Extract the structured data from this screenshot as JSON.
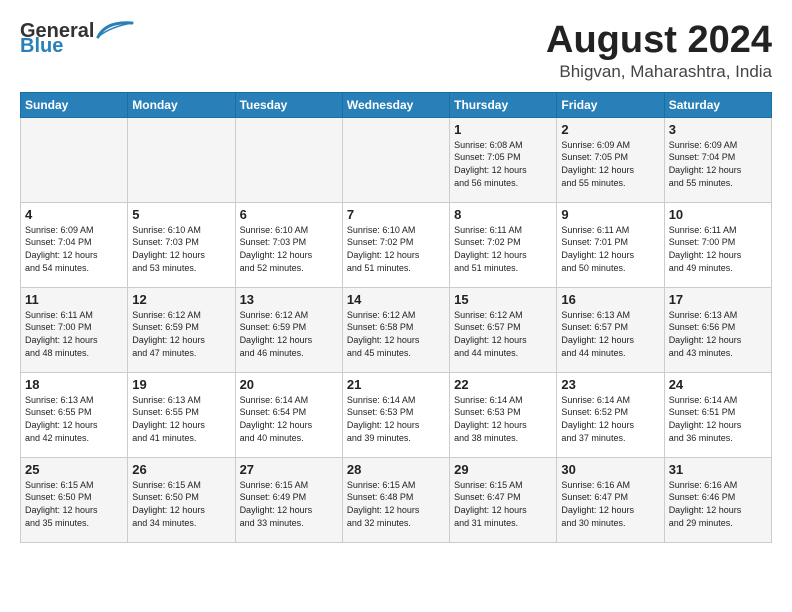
{
  "header": {
    "logo_general": "General",
    "logo_blue": "Blue",
    "title": "August 2024",
    "subtitle": "Bhigvan, Maharashtra, India"
  },
  "weekdays": [
    "Sunday",
    "Monday",
    "Tuesday",
    "Wednesday",
    "Thursday",
    "Friday",
    "Saturday"
  ],
  "weeks": [
    [
      {
        "day": "",
        "info": ""
      },
      {
        "day": "",
        "info": ""
      },
      {
        "day": "",
        "info": ""
      },
      {
        "day": "",
        "info": ""
      },
      {
        "day": "1",
        "info": "Sunrise: 6:08 AM\nSunset: 7:05 PM\nDaylight: 12 hours\nand 56 minutes."
      },
      {
        "day": "2",
        "info": "Sunrise: 6:09 AM\nSunset: 7:05 PM\nDaylight: 12 hours\nand 55 minutes."
      },
      {
        "day": "3",
        "info": "Sunrise: 6:09 AM\nSunset: 7:04 PM\nDaylight: 12 hours\nand 55 minutes."
      }
    ],
    [
      {
        "day": "4",
        "info": "Sunrise: 6:09 AM\nSunset: 7:04 PM\nDaylight: 12 hours\nand 54 minutes."
      },
      {
        "day": "5",
        "info": "Sunrise: 6:10 AM\nSunset: 7:03 PM\nDaylight: 12 hours\nand 53 minutes."
      },
      {
        "day": "6",
        "info": "Sunrise: 6:10 AM\nSunset: 7:03 PM\nDaylight: 12 hours\nand 52 minutes."
      },
      {
        "day": "7",
        "info": "Sunrise: 6:10 AM\nSunset: 7:02 PM\nDaylight: 12 hours\nand 51 minutes."
      },
      {
        "day": "8",
        "info": "Sunrise: 6:11 AM\nSunset: 7:02 PM\nDaylight: 12 hours\nand 51 minutes."
      },
      {
        "day": "9",
        "info": "Sunrise: 6:11 AM\nSunset: 7:01 PM\nDaylight: 12 hours\nand 50 minutes."
      },
      {
        "day": "10",
        "info": "Sunrise: 6:11 AM\nSunset: 7:00 PM\nDaylight: 12 hours\nand 49 minutes."
      }
    ],
    [
      {
        "day": "11",
        "info": "Sunrise: 6:11 AM\nSunset: 7:00 PM\nDaylight: 12 hours\nand 48 minutes."
      },
      {
        "day": "12",
        "info": "Sunrise: 6:12 AM\nSunset: 6:59 PM\nDaylight: 12 hours\nand 47 minutes."
      },
      {
        "day": "13",
        "info": "Sunrise: 6:12 AM\nSunset: 6:59 PM\nDaylight: 12 hours\nand 46 minutes."
      },
      {
        "day": "14",
        "info": "Sunrise: 6:12 AM\nSunset: 6:58 PM\nDaylight: 12 hours\nand 45 minutes."
      },
      {
        "day": "15",
        "info": "Sunrise: 6:12 AM\nSunset: 6:57 PM\nDaylight: 12 hours\nand 44 minutes."
      },
      {
        "day": "16",
        "info": "Sunrise: 6:13 AM\nSunset: 6:57 PM\nDaylight: 12 hours\nand 44 minutes."
      },
      {
        "day": "17",
        "info": "Sunrise: 6:13 AM\nSunset: 6:56 PM\nDaylight: 12 hours\nand 43 minutes."
      }
    ],
    [
      {
        "day": "18",
        "info": "Sunrise: 6:13 AM\nSunset: 6:55 PM\nDaylight: 12 hours\nand 42 minutes."
      },
      {
        "day": "19",
        "info": "Sunrise: 6:13 AM\nSunset: 6:55 PM\nDaylight: 12 hours\nand 41 minutes."
      },
      {
        "day": "20",
        "info": "Sunrise: 6:14 AM\nSunset: 6:54 PM\nDaylight: 12 hours\nand 40 minutes."
      },
      {
        "day": "21",
        "info": "Sunrise: 6:14 AM\nSunset: 6:53 PM\nDaylight: 12 hours\nand 39 minutes."
      },
      {
        "day": "22",
        "info": "Sunrise: 6:14 AM\nSunset: 6:53 PM\nDaylight: 12 hours\nand 38 minutes."
      },
      {
        "day": "23",
        "info": "Sunrise: 6:14 AM\nSunset: 6:52 PM\nDaylight: 12 hours\nand 37 minutes."
      },
      {
        "day": "24",
        "info": "Sunrise: 6:14 AM\nSunset: 6:51 PM\nDaylight: 12 hours\nand 36 minutes."
      }
    ],
    [
      {
        "day": "25",
        "info": "Sunrise: 6:15 AM\nSunset: 6:50 PM\nDaylight: 12 hours\nand 35 minutes."
      },
      {
        "day": "26",
        "info": "Sunrise: 6:15 AM\nSunset: 6:50 PM\nDaylight: 12 hours\nand 34 minutes."
      },
      {
        "day": "27",
        "info": "Sunrise: 6:15 AM\nSunset: 6:49 PM\nDaylight: 12 hours\nand 33 minutes."
      },
      {
        "day": "28",
        "info": "Sunrise: 6:15 AM\nSunset: 6:48 PM\nDaylight: 12 hours\nand 32 minutes."
      },
      {
        "day": "29",
        "info": "Sunrise: 6:15 AM\nSunset: 6:47 PM\nDaylight: 12 hours\nand 31 minutes."
      },
      {
        "day": "30",
        "info": "Sunrise: 6:16 AM\nSunset: 6:47 PM\nDaylight: 12 hours\nand 30 minutes."
      },
      {
        "day": "31",
        "info": "Sunrise: 6:16 AM\nSunset: 6:46 PM\nDaylight: 12 hours\nand 29 minutes."
      }
    ]
  ]
}
